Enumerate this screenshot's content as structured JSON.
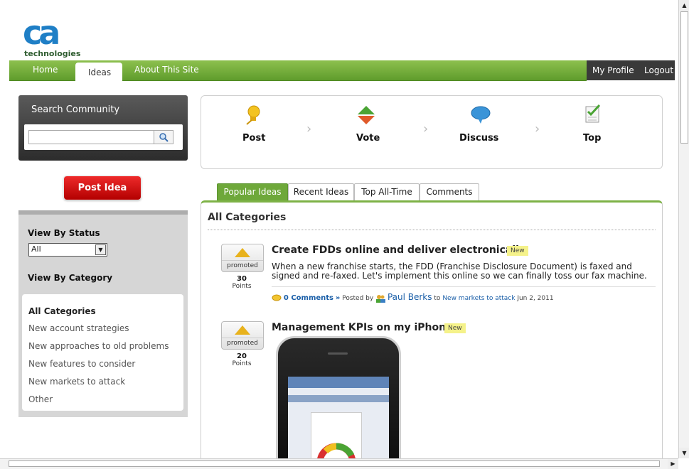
{
  "brand": {
    "logo_text": "ca",
    "logo_sub": "technologies"
  },
  "nav": {
    "home": "Home",
    "ideas": "Ideas",
    "about": "About This Site",
    "profile": "My Profile",
    "logout": "Logout"
  },
  "search": {
    "title": "Search Community",
    "value": "",
    "placeholder": ""
  },
  "post_idea_label": "Post Idea",
  "sidebar": {
    "status_heading": "View By Status",
    "status_selected": "All",
    "category_heading": "View By Category",
    "categories": [
      "All Categories",
      "New account strategies",
      "New approaches to old problems",
      "New features to consider",
      "New markets to attack",
      "Other"
    ]
  },
  "steps": [
    "Post",
    "Vote",
    "Discuss",
    "Top"
  ],
  "tabs": [
    "Popular Ideas",
    "Recent Ideas",
    "Top All-Time",
    "Comments"
  ],
  "content": {
    "category_title": "All Categories",
    "ideas": [
      {
        "title": "Create FDDs online and deliver electronically",
        "badge": "New",
        "status": "promoted",
        "points": "30",
        "points_label": "Points",
        "description": " When a new franchise starts, the FDD (Franchise Disclosure Document) is faxed and signed and re-faxed.  Let's implement this online so we can finally toss our fax machine.",
        "comments": "0 Comments",
        "comments_arrow": "»",
        "posted_by": "Posted by",
        "author": "Paul Berks",
        "to": "to",
        "market": "New markets to attack",
        "date": "Jun 2, 2011"
      },
      {
        "title": "Management KPIs on my iPhone",
        "badge": "New",
        "status": "promoted",
        "points": "20",
        "points_label": "Points"
      }
    ]
  },
  "colors": {
    "nav_green": "#6ea83a",
    "post_red": "#d40000",
    "badge_yellow": "#f5f28a",
    "link_blue": "#1b5fa8"
  }
}
